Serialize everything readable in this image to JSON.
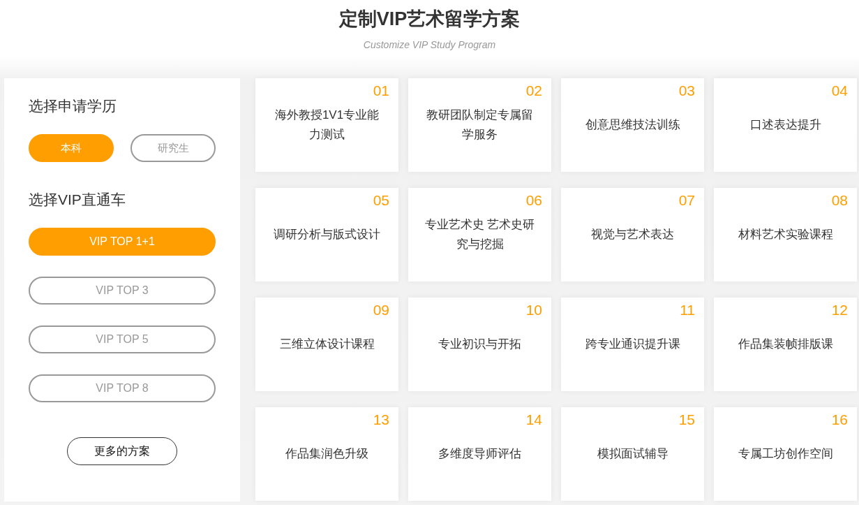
{
  "header": {
    "title": "定制VIP艺术留学方案",
    "subtitle": "Customize VIP Study Program"
  },
  "sidebar": {
    "degree_heading": "选择申请学历",
    "degrees": [
      {
        "label": "本科",
        "selected": true
      },
      {
        "label": "研究生",
        "selected": false
      }
    ],
    "vip_heading": "选择VIP直通车",
    "vip_options": [
      {
        "label": "VIP TOP 1+1",
        "selected": true
      },
      {
        "label": "VIP TOP 3",
        "selected": false
      },
      {
        "label": "VIP TOP 5",
        "selected": false
      },
      {
        "label": "VIP TOP 8",
        "selected": false
      }
    ],
    "more_button": "更多的方案"
  },
  "services": [
    {
      "number": "01",
      "title": "海外教授1V1专业能力测试"
    },
    {
      "number": "02",
      "title": "教研团队制定专属留学服务"
    },
    {
      "number": "03",
      "title": "创意思维技法训练"
    },
    {
      "number": "04",
      "title": "口述表达提升"
    },
    {
      "number": "05",
      "title": "调研分析与版式设计"
    },
    {
      "number": "06",
      "title": "专业艺术史 艺术史研究与挖掘"
    },
    {
      "number": "07",
      "title": "视觉与艺术表达"
    },
    {
      "number": "08",
      "title": "材料艺术实验课程"
    },
    {
      "number": "09",
      "title": "三维立体设计课程"
    },
    {
      "number": "10",
      "title": "专业初识与开拓"
    },
    {
      "number": "11",
      "title": "跨专业通识提升课"
    },
    {
      "number": "12",
      "title": "作品集装帧排版课"
    },
    {
      "number": "13",
      "title": "作品集润色升级"
    },
    {
      "number": "14",
      "title": "多维度导师评估"
    },
    {
      "number": "15",
      "title": "模拟面试辅导"
    },
    {
      "number": "16",
      "title": "专属工坊创作空间"
    }
  ]
}
